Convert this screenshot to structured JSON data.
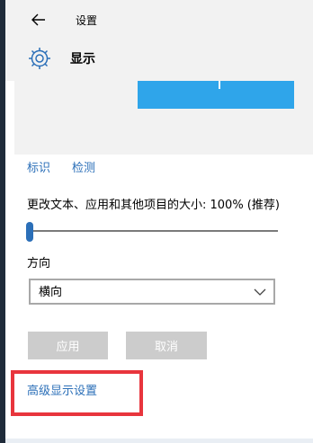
{
  "window": {
    "title": "设置"
  },
  "header": {
    "title": "显示"
  },
  "links": {
    "identify": "标识",
    "detect": "检测",
    "advanced": "高级显示设置"
  },
  "scale": {
    "label": "更改文本、应用和其他项目的大小: 100% (推荐)",
    "value_percent": 100
  },
  "orientation": {
    "label": "方向",
    "selected": "横向"
  },
  "buttons": {
    "apply": "应用",
    "cancel": "取消"
  },
  "icons": {
    "back": "back-arrow-icon",
    "settings": "gear-icon",
    "dropdown": "chevron-down-icon"
  },
  "colors": {
    "accent": "#2b6fb8",
    "monitor": "#2fa5ea",
    "highlight_box": "#e8353d",
    "disabled_button": "#cccccc"
  }
}
